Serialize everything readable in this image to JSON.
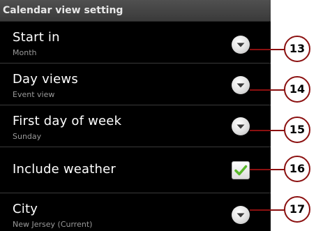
{
  "header": {
    "title": "Calendar view setting"
  },
  "rows": [
    {
      "title": "Start in",
      "subtitle": "Month",
      "control": "dropdown-icon",
      "callout": "13"
    },
    {
      "title": "Day views",
      "subtitle": "Event view",
      "control": "dropdown-icon",
      "callout": "14"
    },
    {
      "title": "First day of week",
      "subtitle": "Sunday",
      "control": "dropdown-icon",
      "callout": "15"
    },
    {
      "title": "Include weather",
      "subtitle": "",
      "control": "checkbox-checked",
      "checked": true,
      "callout": "16"
    },
    {
      "title": "City",
      "subtitle": "New Jersey (Current)",
      "control": "dropdown-icon",
      "callout": "17"
    }
  ],
  "colors": {
    "panel_background": "#000000",
    "callout_border": "#8b1010",
    "check_mark": "#5ab82b"
  }
}
